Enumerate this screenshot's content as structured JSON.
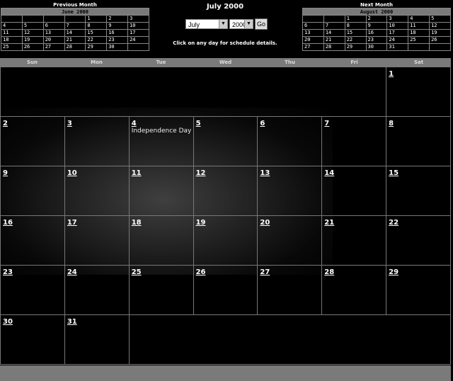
{
  "page": {
    "title": "July 2000",
    "hint": "Click on any day for schedule details.",
    "month_value": "July",
    "year_value": "2000",
    "go_label": "Go"
  },
  "prev": {
    "caption": "Previous Month",
    "header": "June 2000",
    "weeks": [
      [
        "",
        "",
        "",
        "",
        "1",
        "2",
        "3"
      ],
      [
        "4",
        "5",
        "6",
        "7",
        "8",
        "9",
        "10"
      ],
      [
        "11",
        "12",
        "13",
        "14",
        "15",
        "16",
        "17"
      ],
      [
        "18",
        "19",
        "20",
        "21",
        "22",
        "23",
        "24"
      ],
      [
        "25",
        "26",
        "27",
        "28",
        "29",
        "30",
        ""
      ]
    ]
  },
  "next": {
    "caption": "Next Month",
    "header": "August 2000",
    "weeks": [
      [
        "",
        "",
        "1",
        "2",
        "3",
        "4",
        "5"
      ],
      [
        "6",
        "7",
        "8",
        "9",
        "10",
        "11",
        "12"
      ],
      [
        "13",
        "14",
        "15",
        "16",
        "17",
        "18",
        "19"
      ],
      [
        "20",
        "21",
        "22",
        "23",
        "24",
        "25",
        "26"
      ],
      [
        "27",
        "28",
        "29",
        "30",
        "31",
        "",
        ""
      ]
    ]
  },
  "main": {
    "days": [
      "Sun",
      "Mon",
      "Tue",
      "Wed",
      "Thu",
      "Fri",
      "Sat"
    ],
    "weeks": [
      [
        "",
        "",
        "",
        "",
        "",
        "",
        "1"
      ],
      [
        "2",
        "3",
        "4",
        "5",
        "6",
        "7",
        "8"
      ],
      [
        "9",
        "10",
        "11",
        "12",
        "13",
        "14",
        "15"
      ],
      [
        "16",
        "17",
        "18",
        "19",
        "20",
        "21",
        "22"
      ],
      [
        "23",
        "24",
        "25",
        "26",
        "27",
        "28",
        "29"
      ],
      [
        "30",
        "31",
        "",
        "",
        "",
        "",
        ""
      ]
    ],
    "events": {
      "4": "Independence Day"
    }
  }
}
